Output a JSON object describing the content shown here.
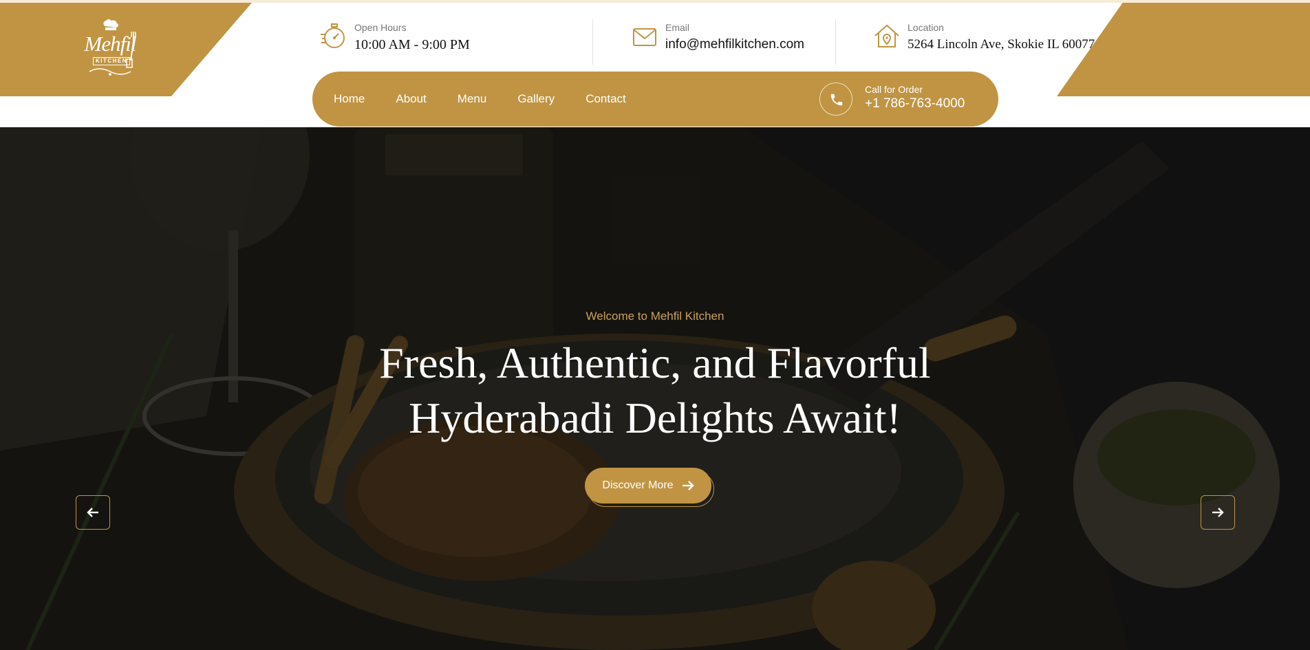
{
  "brand": {
    "logo_text": "Mehfil",
    "logo_subtext": "KITCHEN",
    "accent_color": "#c09443"
  },
  "header": {
    "hours": {
      "label": "Open Hours",
      "value": "10:00 AM - 9:00 PM",
      "icon": "stopwatch-icon"
    },
    "email": {
      "label": "Email",
      "value": "info@mehfilkitchen.com",
      "icon": "envelope-icon"
    },
    "location": {
      "label": "Location",
      "value": "5264 Lincoln Ave, Skokie IL 60077",
      "icon": "home-location-icon"
    }
  },
  "nav": {
    "items": [
      "Home",
      "About",
      "Menu",
      "Gallery",
      "Contact"
    ],
    "call": {
      "label": "Call for Order",
      "number": "+1 786-763-4000",
      "icon": "phone-icon"
    }
  },
  "hero": {
    "tagline": "Welcome to Mehfil Kitchen",
    "headline_line1": "Fresh, Authentic, and Flavorful",
    "headline_line2": "Hyderabadi Delights Await!",
    "cta_label": "Discover More",
    "prev_icon": "arrow-left-icon",
    "next_icon": "arrow-right-icon"
  }
}
